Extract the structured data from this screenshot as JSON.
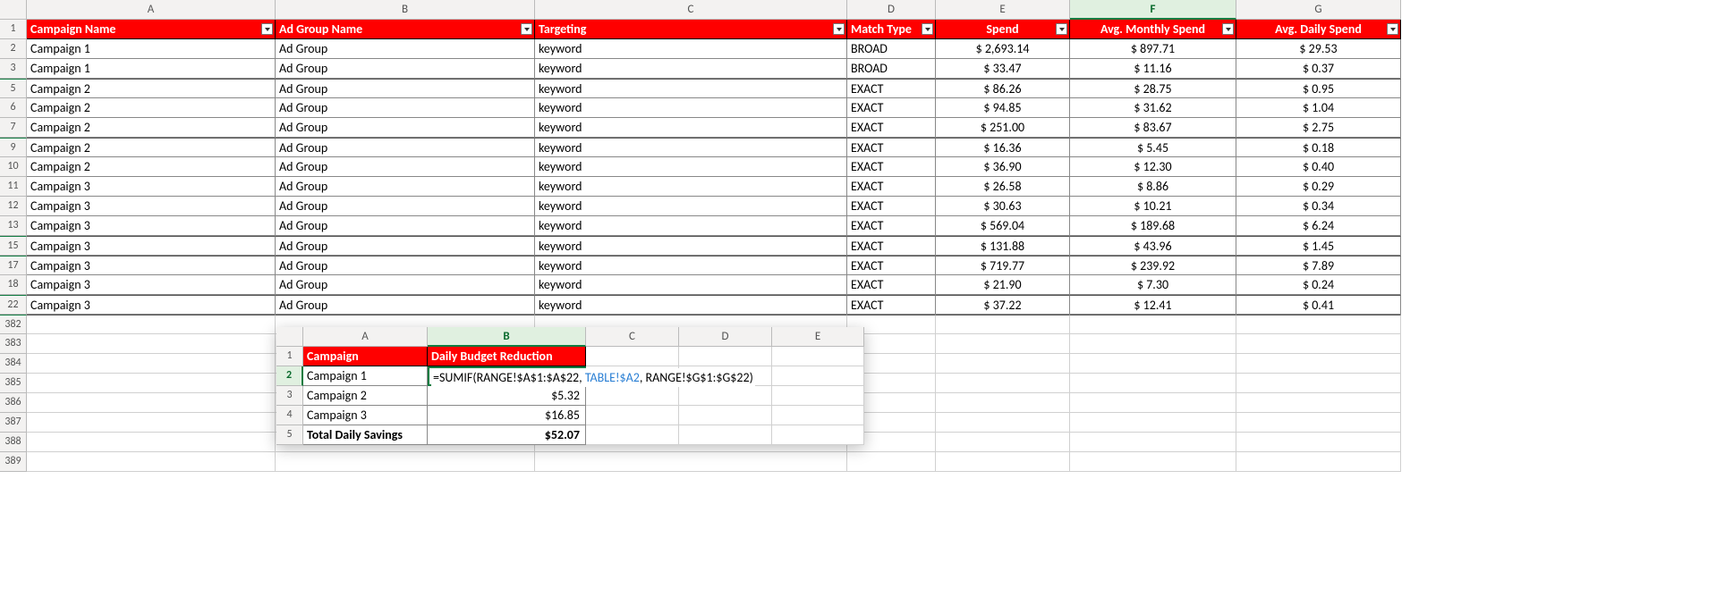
{
  "main": {
    "columns": [
      "A",
      "B",
      "C",
      "D",
      "E",
      "F",
      "G"
    ],
    "headers": {
      "A": "Campaign Name",
      "B": "Ad Group Name",
      "C": "Targeting",
      "D": "Match Type",
      "E": "Spend",
      "F": "Avg. Monthly Spend",
      "G": "Avg. Daily Spend"
    },
    "rows": [
      {
        "n": 2,
        "A": "Campaign 1",
        "B": "Ad Group",
        "C": "keyword",
        "D": "BROAD",
        "E": "$ 2,693.14",
        "F": "$ 897.71",
        "G": "$ 29.53"
      },
      {
        "n": 3,
        "A": "Campaign 1",
        "B": "Ad Group",
        "C": "keyword",
        "D": "BROAD",
        "E": "$ 33.47",
        "F": "$ 11.16",
        "G": "$ 0.37"
      },
      {
        "n": 5,
        "A": "Campaign 2",
        "B": "Ad Group",
        "C": "keyword",
        "D": "EXACT",
        "E": "$ 86.26",
        "F": "$ 28.75",
        "G": "$ 0.95"
      },
      {
        "n": 6,
        "A": "Campaign 2",
        "B": "Ad Group",
        "C": "keyword",
        "D": "EXACT",
        "E": "$ 94.85",
        "F": "$ 31.62",
        "G": "$ 1.04"
      },
      {
        "n": 7,
        "A": "Campaign 2",
        "B": "Ad Group",
        "C": "keyword",
        "D": "EXACT",
        "E": "$ 251.00",
        "F": "$ 83.67",
        "G": "$ 2.75"
      },
      {
        "n": 9,
        "A": "Campaign 2",
        "B": "Ad Group",
        "C": "keyword",
        "D": "EXACT",
        "E": "$ 16.36",
        "F": "$ 5.45",
        "G": "$ 0.18"
      },
      {
        "n": 10,
        "A": "Campaign 2",
        "B": "Ad Group",
        "C": "keyword",
        "D": "EXACT",
        "E": "$ 36.90",
        "F": "$ 12.30",
        "G": "$ 0.40"
      },
      {
        "n": 11,
        "A": "Campaign 3",
        "B": "Ad Group",
        "C": "keyword",
        "D": "EXACT",
        "E": "$ 26.58",
        "F": "$ 8.86",
        "G": "$ 0.29"
      },
      {
        "n": 12,
        "A": "Campaign 3",
        "B": "Ad Group",
        "C": "keyword",
        "D": "EXACT",
        "E": "$ 30.63",
        "F": "$ 10.21",
        "G": "$ 0.34"
      },
      {
        "n": 13,
        "A": "Campaign 3",
        "B": "Ad Group",
        "C": "keyword",
        "D": "EXACT",
        "E": "$ 569.04",
        "F": "$ 189.68",
        "G": "$ 6.24"
      },
      {
        "n": 15,
        "A": "Campaign 3",
        "B": "Ad Group",
        "C": "keyword",
        "D": "EXACT",
        "E": "$ 131.88",
        "F": "$ 43.96",
        "G": "$ 1.45"
      },
      {
        "n": 17,
        "A": "Campaign 3",
        "B": "Ad Group",
        "C": "keyword",
        "D": "EXACT",
        "E": "$ 719.77",
        "F": "$ 239.92",
        "G": "$ 7.89"
      },
      {
        "n": 18,
        "A": "Campaign 3",
        "B": "Ad Group",
        "C": "keyword",
        "D": "EXACT",
        "E": "$ 21.90",
        "F": "$ 7.30",
        "G": "$ 0.24"
      },
      {
        "n": 22,
        "A": "Campaign 3",
        "B": "Ad Group",
        "C": "keyword",
        "D": "EXACT",
        "E": "$ 37.22",
        "F": "$ 12.41",
        "G": "$ 0.41"
      }
    ],
    "tail_row_numbers": [
      "382",
      "383",
      "384",
      "385",
      "386",
      "387",
      "388",
      "389"
    ],
    "hidden_before": [
      5,
      9,
      15,
      17,
      22,
      382
    ]
  },
  "inner": {
    "columns": [
      "A",
      "B",
      "C",
      "D",
      "E"
    ],
    "headers": {
      "A": "Campaign",
      "B": "Daily Budget Reduction"
    },
    "formula": {
      "prefix": "=SUMIF(",
      "arg1": "RANGE!$A$1:$A$22",
      "sep1": ", ",
      "arg2": "TABLE!$A2",
      "sep2": ", ",
      "arg3": "RANGE!$G$1:$G$22",
      "suffix": ")"
    },
    "rows": [
      {
        "n": 2,
        "A": "Campaign 1",
        "B": "__FORMULA__"
      },
      {
        "n": 3,
        "A": "Campaign 2",
        "B": "$5.32"
      },
      {
        "n": 4,
        "A": "Campaign 3",
        "B": "$16.85"
      },
      {
        "n": 5,
        "A": "Total Daily Savings",
        "B": "$52.07",
        "bold": true
      }
    ]
  },
  "chart_data": {
    "type": "table",
    "main_table": {
      "columns": [
        "Campaign Name",
        "Ad Group Name",
        "Targeting",
        "Match Type",
        "Spend",
        "Avg. Monthly Spend",
        "Avg. Daily Spend"
      ],
      "rows": [
        [
          "Campaign 1",
          "Ad Group",
          "keyword",
          "BROAD",
          2693.14,
          897.71,
          29.53
        ],
        [
          "Campaign 1",
          "Ad Group",
          "keyword",
          "BROAD",
          33.47,
          11.16,
          0.37
        ],
        [
          "Campaign 2",
          "Ad Group",
          "keyword",
          "EXACT",
          86.26,
          28.75,
          0.95
        ],
        [
          "Campaign 2",
          "Ad Group",
          "keyword",
          "EXACT",
          94.85,
          31.62,
          1.04
        ],
        [
          "Campaign 2",
          "Ad Group",
          "keyword",
          "EXACT",
          251.0,
          83.67,
          2.75
        ],
        [
          "Campaign 2",
          "Ad Group",
          "keyword",
          "EXACT",
          16.36,
          5.45,
          0.18
        ],
        [
          "Campaign 2",
          "Ad Group",
          "keyword",
          "EXACT",
          36.9,
          12.3,
          0.4
        ],
        [
          "Campaign 3",
          "Ad Group",
          "keyword",
          "EXACT",
          26.58,
          8.86,
          0.29
        ],
        [
          "Campaign 3",
          "Ad Group",
          "keyword",
          "EXACT",
          30.63,
          10.21,
          0.34
        ],
        [
          "Campaign 3",
          "Ad Group",
          "keyword",
          "EXACT",
          569.04,
          189.68,
          6.24
        ],
        [
          "Campaign 3",
          "Ad Group",
          "keyword",
          "EXACT",
          131.88,
          43.96,
          1.45
        ],
        [
          "Campaign 3",
          "Ad Group",
          "keyword",
          "EXACT",
          719.77,
          239.92,
          7.89
        ],
        [
          "Campaign 3",
          "Ad Group",
          "keyword",
          "EXACT",
          21.9,
          7.3,
          0.24
        ],
        [
          "Campaign 3",
          "Ad Group",
          "keyword",
          "EXACT",
          37.22,
          12.41,
          0.41
        ]
      ]
    },
    "summary_table": {
      "columns": [
        "Campaign",
        "Daily Budget Reduction"
      ],
      "rows": [
        [
          "Campaign 1",
          "=SUMIF(RANGE!$A$1:$A$22, TABLE!$A2, RANGE!$G$1:$G$22)"
        ],
        [
          "Campaign 2",
          5.32
        ],
        [
          "Campaign 3",
          16.85
        ],
        [
          "Total Daily Savings",
          52.07
        ]
      ]
    }
  }
}
